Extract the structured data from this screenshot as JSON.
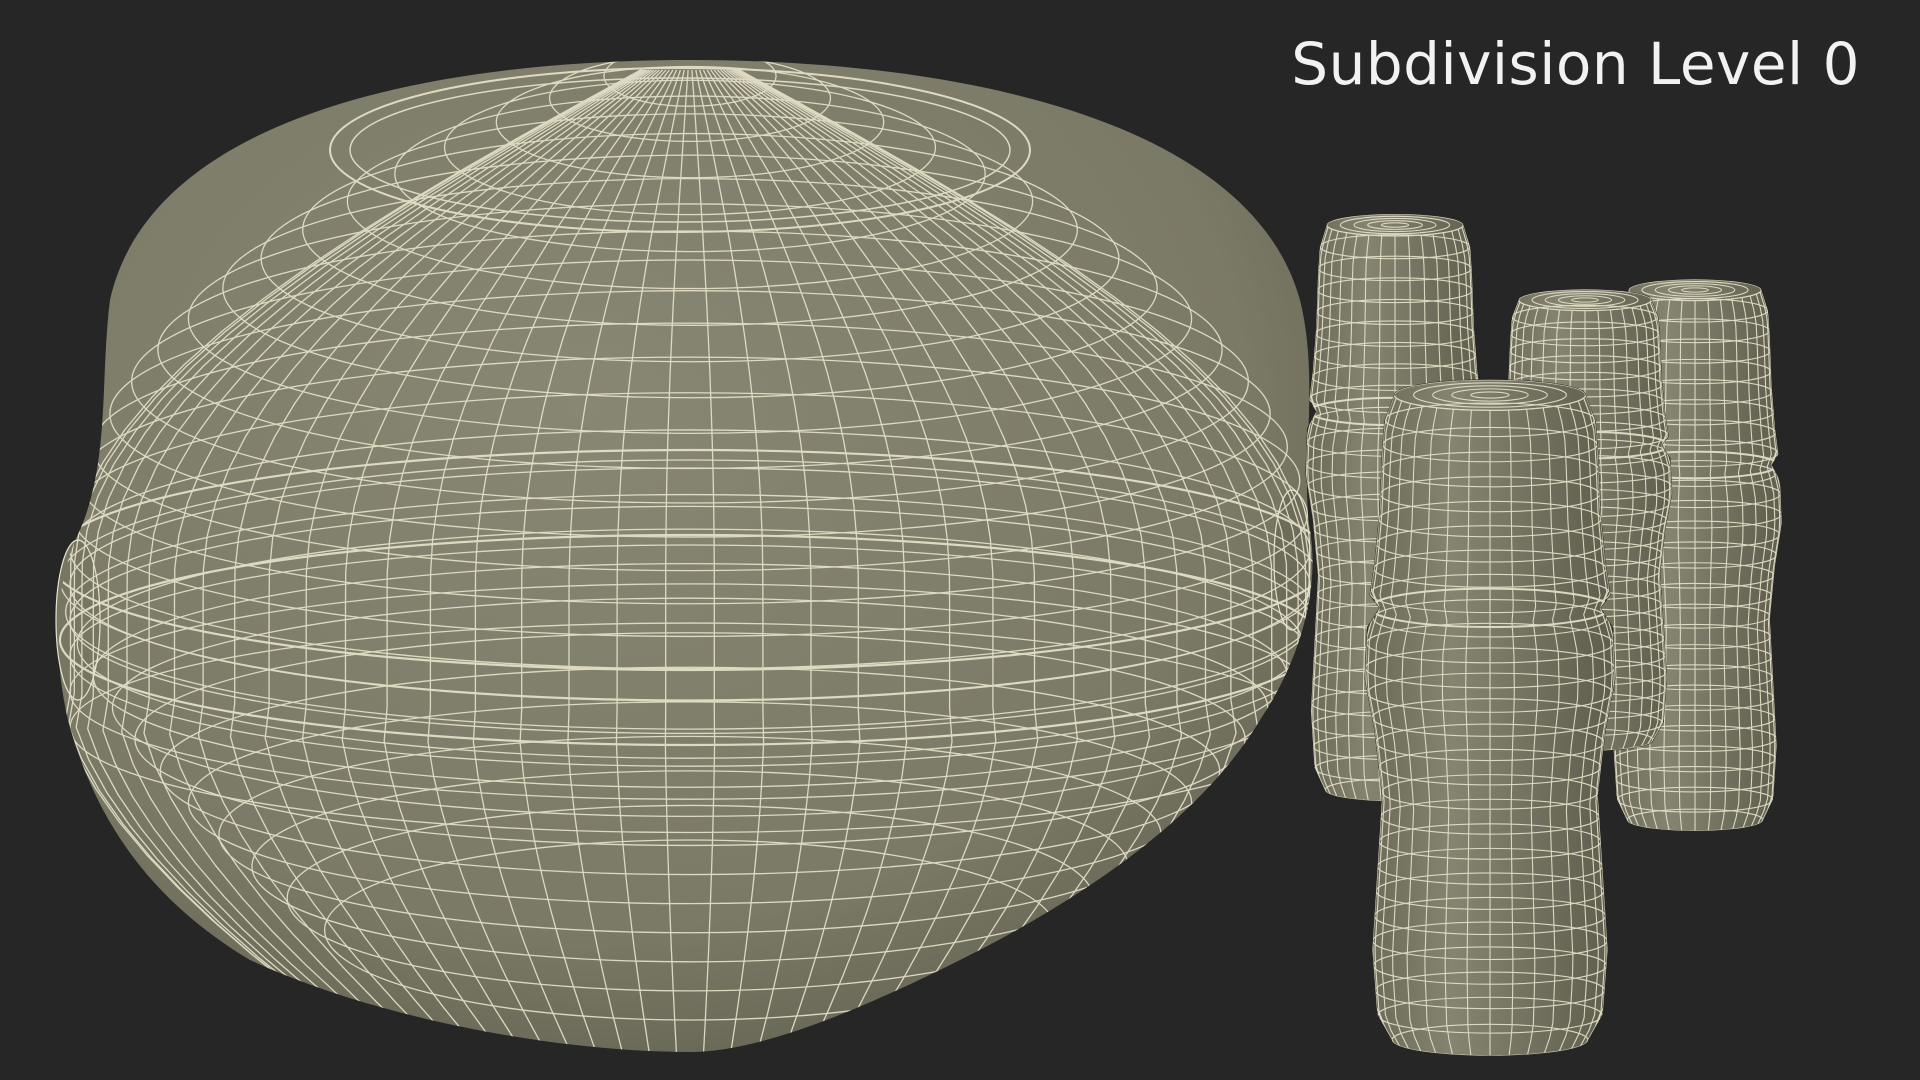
{
  "caption": {
    "text": "Subdivision Level 0"
  },
  "colors": {
    "background": "#262626",
    "surface": "#7d7c68",
    "surface_shadow": "#5f5e4e",
    "wireframe": "#e8e4cc",
    "caption": "#f2f2f2"
  },
  "scene": {
    "objects": [
      {
        "name": "bowl-with-lid",
        "kind": "rounded-bowl"
      },
      {
        "name": "bottle-back-left",
        "kind": "small-bottle"
      },
      {
        "name": "bottle-back-middle",
        "kind": "small-bottle"
      },
      {
        "name": "bottle-back-right",
        "kind": "small-bottle"
      },
      {
        "name": "bottle-front",
        "kind": "small-bottle"
      }
    ]
  }
}
